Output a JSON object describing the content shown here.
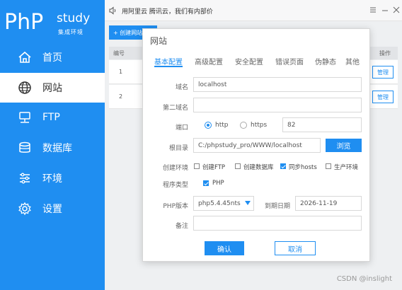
{
  "logo": {
    "php": "PhP",
    "study": "study",
    "sub": "集成环境"
  },
  "sidebar": {
    "items": [
      {
        "label": "首页",
        "icon": "home-icon"
      },
      {
        "label": "网站",
        "icon": "globe-icon",
        "active": true
      },
      {
        "label": "FTP",
        "icon": "ftp-icon"
      },
      {
        "label": "数据库",
        "icon": "database-icon"
      },
      {
        "label": "环境",
        "icon": "sliders-icon"
      },
      {
        "label": "设置",
        "icon": "gear-icon"
      }
    ]
  },
  "topbar": {
    "notice": "用阿里云 腾讯云，我们有内部价"
  },
  "main": {
    "create_label": "+ 创建网站",
    "col_no": "编号",
    "col_op": "操作",
    "rows": [
      {
        "no": "1",
        "op": "管理"
      },
      {
        "no": "2",
        "op": "管理"
      }
    ]
  },
  "modal": {
    "title": "网站",
    "tabs": [
      "基本配置",
      "高级配置",
      "安全配置",
      "错误页面",
      "伪静态",
      "其他"
    ],
    "domain_label": "域名",
    "domain_value": "localhost",
    "domain2_label": "第二域名",
    "domain2_value": "",
    "port_label": "端口",
    "http_label": "http",
    "https_label": "https",
    "port_value": "82",
    "root_label": "根目录",
    "root_value": "C:/phpstudy_pro/WWW/localhost",
    "browse_label": "浏览",
    "env_label": "创建环境",
    "env_options": [
      {
        "label": "创建FTP",
        "checked": false
      },
      {
        "label": "创建数据库",
        "checked": false
      },
      {
        "label": "同步hosts",
        "checked": true
      },
      {
        "label": "生产环境",
        "checked": false
      }
    ],
    "type_label": "程序类型",
    "type_option": "PHP",
    "php_label": "PHP版本",
    "php_value": "php5.4.45nts",
    "expire_label": "到期日期",
    "expire_value": "2026-11-19",
    "note_label": "备注",
    "note_value": "",
    "ok_label": "确认",
    "cancel_label": "取消"
  },
  "watermark": "CSDN @inslight",
  "colors": {
    "accent": "#1f8ef1"
  }
}
